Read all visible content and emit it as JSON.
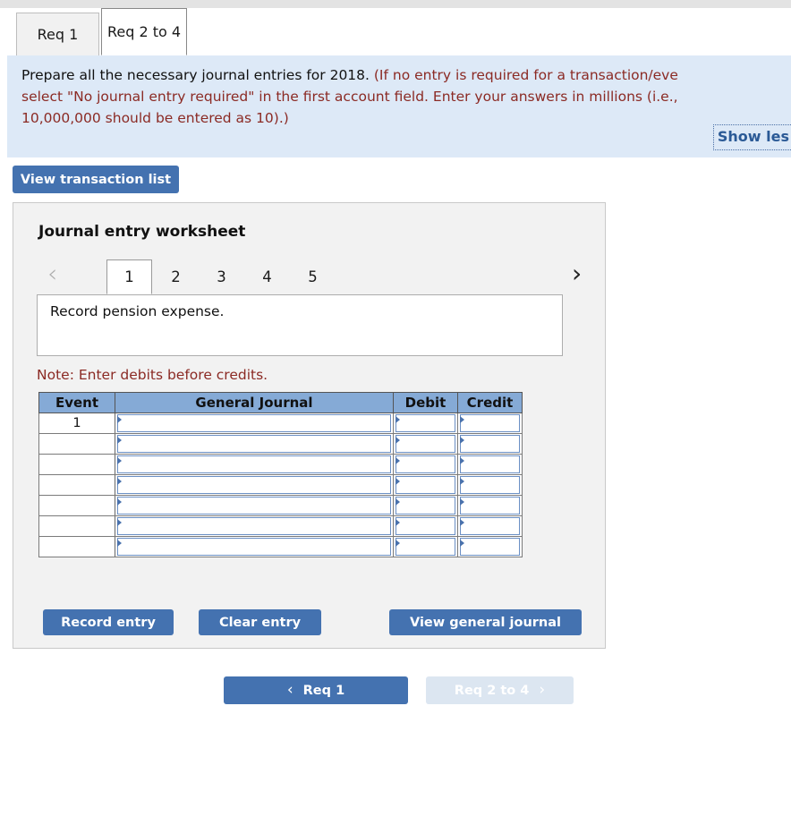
{
  "tabs": [
    {
      "label": "Req 1",
      "active": false
    },
    {
      "label": "Req 2 to 4",
      "active": true
    }
  ],
  "instructions": {
    "line1_black": "Prepare all the necessary journal entries for 2018.",
    "line1_red": " (If no entry is required for a transaction/eve",
    "line2_red": "select \"No journal entry required\" in the first account field. Enter your answers in millions (i.e.,",
    "line3_red": "10,000,000 should be entered as 10).)",
    "show_less_label": "Show les"
  },
  "view_transaction_list_label": "View transaction list",
  "worksheet": {
    "title": "Journal entry worksheet",
    "prev_arrow": "‹",
    "next_arrow": "›",
    "pages": [
      "1",
      "2",
      "3",
      "4",
      "5"
    ],
    "active_page": "1",
    "description": "Record pension expense.",
    "note": "Note: Enter debits before credits.",
    "table": {
      "headers": [
        "Event",
        "General Journal",
        "Debit",
        "Credit"
      ],
      "rows": [
        {
          "event": "1",
          "general_journal": "",
          "debit": "",
          "credit": ""
        },
        {
          "event": "",
          "general_journal": "",
          "debit": "",
          "credit": ""
        },
        {
          "event": "",
          "general_journal": "",
          "debit": "",
          "credit": ""
        },
        {
          "event": "",
          "general_journal": "",
          "debit": "",
          "credit": ""
        },
        {
          "event": "",
          "general_journal": "",
          "debit": "",
          "credit": ""
        },
        {
          "event": "",
          "general_journal": "",
          "debit": "",
          "credit": ""
        },
        {
          "event": "",
          "general_journal": "",
          "debit": "",
          "credit": ""
        }
      ]
    },
    "buttons": {
      "record_entry": "Record entry",
      "clear_entry": "Clear entry",
      "view_general_journal": "View general journal"
    }
  },
  "bottom_nav": {
    "prev_label": "Req 1",
    "prev_chevron": "‹",
    "next_label": "Req 2 to 4",
    "next_chevron": "›"
  },
  "colors": {
    "button_blue": "#4472b0",
    "instruction_bg": "#dde9f7",
    "table_header_blue": "#85aad6",
    "red_text": "#8b2a24",
    "disabled_nav": "#dce6f1"
  }
}
